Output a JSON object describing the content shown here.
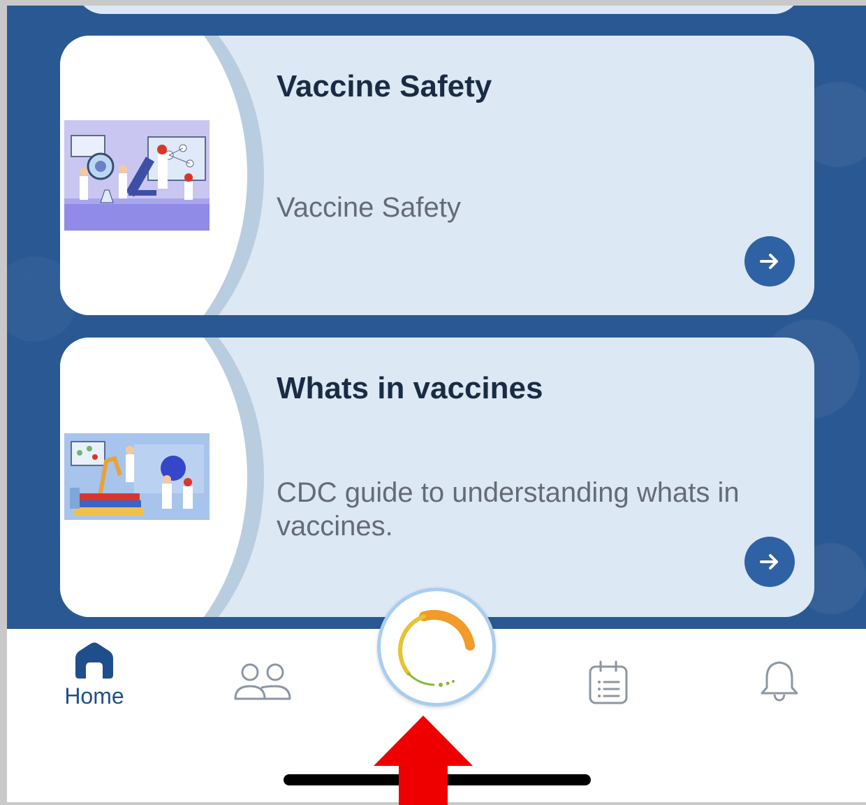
{
  "cards": [
    {
      "title": "Vaccine Safety",
      "description": "Vaccine Safety",
      "image_icon": "scientists-lab-illustration"
    },
    {
      "title": "Whats in vaccines",
      "description": "CDC guide to understanding whats in vaccines.",
      "image_icon": "lab-research-illustration"
    }
  ],
  "bottom_nav": {
    "home_label": "Home",
    "items": [
      "home-icon",
      "people-icon",
      "app-logo-icon",
      "calendar-list-icon",
      "bell-icon"
    ]
  },
  "colors": {
    "background": "#2a5893",
    "card": "#dce8f4",
    "accent": "#2e62a4",
    "nav_active": "#1f4f8a",
    "annotation_arrow": "#ee0000"
  }
}
